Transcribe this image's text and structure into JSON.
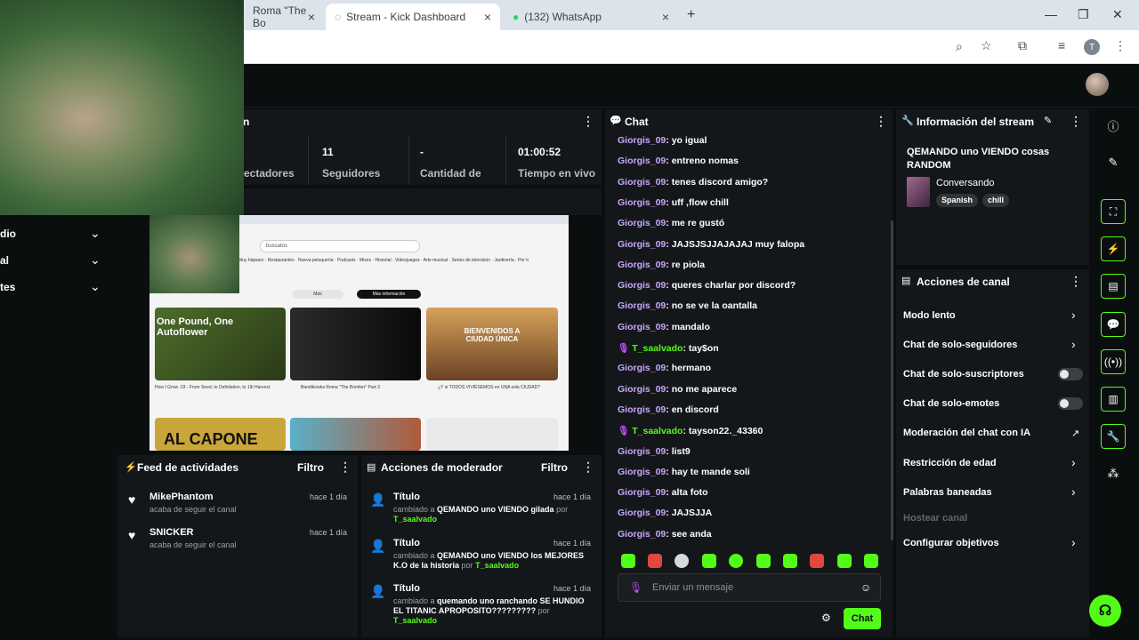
{
  "browser": {
    "tabs": [
      {
        "title": "Roma \"The Bo",
        "active": false
      },
      {
        "title": "Stream - Kick Dashboard",
        "active": true
      },
      {
        "title": "(132) WhatsApp",
        "active": false
      }
    ],
    "new_tab": "+",
    "close": "×",
    "window_controls": {
      "minimize": "—",
      "maximize": "❐",
      "close": "✕"
    },
    "profile_initial": "T"
  },
  "colors": {
    "accent": "#53fc18",
    "username": "#c9a6ff",
    "panel": "#141719"
  },
  "stream_panel": {
    "title_fragment": "n"
  },
  "stats": [
    {
      "value": "",
      "label": "ectadores"
    },
    {
      "value": "11",
      "label": "Seguidores"
    },
    {
      "value": "-",
      "label": "Cantidad de"
    },
    {
      "value": "01:00:52",
      "label": "Tiempo en vivo"
    }
  ],
  "left_nav": [
    {
      "label": "dio"
    },
    {
      "label": "al"
    },
    {
      "label": "tes"
    }
  ],
  "preview": {
    "search_text": "buscatos",
    "chips": [
      "Muy hispano",
      "Restaurantes",
      "Nueva peluquería",
      "Podcasts",
      "Mixes",
      "Historial",
      "Videojuegos",
      "Arte musical",
      "Series de televisión",
      "Jardinería",
      "Por ti"
    ],
    "videos": [
      {
        "title": "How I Grow .03 - From Seed, to Defoliation, to 1lb Harvest",
        "thumb_text": "One Pound, One Autoflower"
      },
      {
        "title": "Bandikowka Roma \"The Bomber\" Part 3",
        "thumb_text": ""
      },
      {
        "title": "¿Y si TODOS VIVIÉSEMOS en UNA sola CIUDAD?",
        "thumb_text": "BIENVENIDOS A CIUDAD ÚNICA"
      }
    ],
    "row2_thumb_text": "AL CAPONE",
    "tabs": [
      "Más",
      "Más información"
    ]
  },
  "activity_feed": {
    "title": "Feed de actividades",
    "filter": "Filtro",
    "items": [
      {
        "name": "MikePhantom",
        "sub": "acaba de seguir el canal",
        "time": "hace 1 día"
      },
      {
        "name": "SNICKER",
        "sub": "acaba de seguir el canal",
        "time": "hace 1 día"
      }
    ]
  },
  "moderator": {
    "title": "Acciones de moderador",
    "filter": "Filtro",
    "items": [
      {
        "title": "Título",
        "time": "hace 1 día",
        "prefix": "cambiado a",
        "value": "QEMANDO uno VIENDO gilada",
        "by": "por",
        "user": "T_saalvado"
      },
      {
        "title": "Título",
        "time": "hace 1 día",
        "prefix": "cambiado a",
        "value": "QEMANDO uno VIENDO los MEJORES K.O de la historia",
        "by": "por",
        "user": "T_saalvado"
      },
      {
        "title": "Título",
        "time": "hace 1 día",
        "prefix": "cambiado a",
        "value": "quemando uno ranchando SE HUNDIO EL TITANIC APROPOSITO?????????",
        "by": "por",
        "user": "T_saalvado"
      }
    ]
  },
  "chat": {
    "title": "Chat",
    "messages": [
      {
        "user": "Giorgis_09",
        "text": "yo igual",
        "mic": false
      },
      {
        "user": "Giorgis_09",
        "text": "entreno nomas",
        "mic": false
      },
      {
        "user": "Giorgis_09",
        "text": "tenes discord amigo?",
        "mic": false
      },
      {
        "user": "Giorgis_09",
        "text": "uff ,flow chill",
        "mic": false
      },
      {
        "user": "Giorgis_09",
        "text": "me re gustó",
        "mic": false
      },
      {
        "user": "Giorgis_09",
        "text": "JAJSJSJJAJAJAJ muy falopa",
        "mic": false
      },
      {
        "user": "Giorgis_09",
        "text": "re piola",
        "mic": false
      },
      {
        "user": "Giorgis_09",
        "text": "queres charlar por discord?",
        "mic": false
      },
      {
        "user": "Giorgis_09",
        "text": "no se ve la oantalla",
        "mic": false
      },
      {
        "user": "Giorgis_09",
        "text": "mandalo",
        "mic": false
      },
      {
        "user": "T_saalvado",
        "text": "tay$on",
        "mic": true
      },
      {
        "user": "Giorgis_09",
        "text": "hermano",
        "mic": false
      },
      {
        "user": "Giorgis_09",
        "text": "no me aparece",
        "mic": false
      },
      {
        "user": "Giorgis_09",
        "text": "en discord",
        "mic": false
      },
      {
        "user": "T_saalvado",
        "text": "tayson22._43360",
        "mic": true
      },
      {
        "user": "Giorgis_09",
        "text": "list9",
        "mic": false
      },
      {
        "user": "Giorgis_09",
        "text": "hay te mande soli",
        "mic": false
      },
      {
        "user": "Giorgis_09",
        "text": "alta foto",
        "mic": false
      },
      {
        "user": "Giorgis_09",
        "text": "JAJSJJA",
        "mic": false
      },
      {
        "user": "Giorgis_09",
        "text": "see anda",
        "mic": false
      }
    ],
    "input_placeholder": "Enviar un mensaje",
    "send_label": "Chat"
  },
  "stream_info": {
    "title": "Información del stream",
    "stream_title": "QEMANDO uno VIENDO cosas RANDOM",
    "category": "Conversando",
    "tags": [
      "Spanish",
      "chill"
    ]
  },
  "channel_actions": {
    "title": "Acciones de canal",
    "items": [
      {
        "label": "Modo lento",
        "control": "chevron"
      },
      {
        "label": "Chat de solo-seguidores",
        "control": "chevron"
      },
      {
        "label": "Chat de solo-suscriptores",
        "control": "toggle"
      },
      {
        "label": "Chat de solo-emotes",
        "control": "toggle"
      },
      {
        "label": "Moderación del chat con IA",
        "control": "external"
      },
      {
        "label": "Restricción de edad",
        "control": "chevron"
      },
      {
        "label": "Palabras baneadas",
        "control": "chevron"
      },
      {
        "label": "Hostear canal",
        "control": "none"
      },
      {
        "label": "Configurar objetivos",
        "control": "chevron"
      }
    ]
  }
}
